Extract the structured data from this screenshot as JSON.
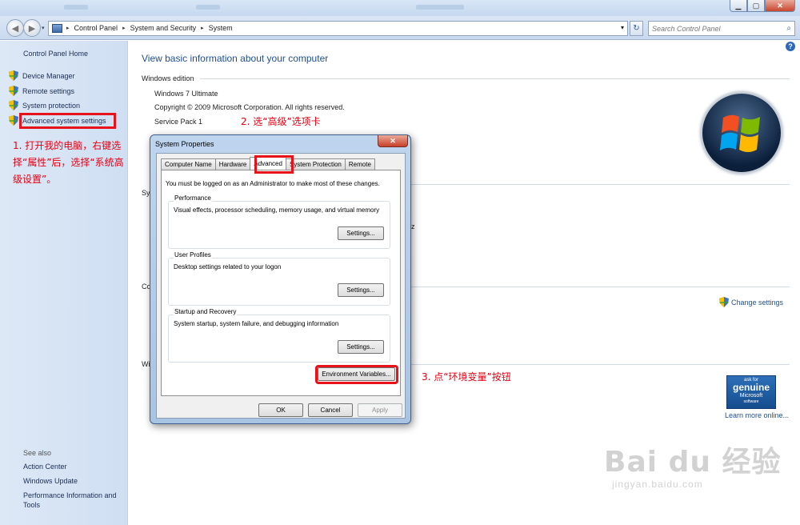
{
  "window": {
    "minimize_glyph": "▁",
    "maximize_glyph": "▢",
    "close_glyph": "✕"
  },
  "nav": {
    "back_glyph": "◀",
    "forward_glyph": "▶",
    "dropdown_glyph": "▾",
    "breadcrumb": [
      "Control Panel",
      "System and Security",
      "System"
    ],
    "separator_glyph": "▸",
    "refresh_glyph": "↻",
    "search_placeholder": "Search Control Panel",
    "search_glyph": "⌕"
  },
  "sidebar": {
    "home": "Control Panel Home",
    "items": [
      {
        "label": "Device Manager",
        "icon": "shield-icon"
      },
      {
        "label": "Remote settings",
        "icon": "shield-icon"
      },
      {
        "label": "System protection",
        "icon": "shield-icon"
      },
      {
        "label": "Advanced system settings",
        "icon": "shield-icon"
      }
    ],
    "see_also": "See also",
    "see_also_links": [
      "Action Center",
      "Windows Update",
      "Performance Information and Tools"
    ]
  },
  "main": {
    "title": "View basic information about your computer",
    "help_glyph": "?",
    "edition_header": "Windows edition",
    "edition_lines": [
      "Windows 7 Ultimate",
      "Copyright © 2009 Microsoft Corporation.  All rights reserved.",
      "Service Pack 1"
    ],
    "partial_labels": [
      "Sy",
      "Co",
      "Wi",
      "z"
    ],
    "change_settings": "Change settings",
    "genuine": {
      "line1": "ask for",
      "line2": "genuine",
      "line3": "Microsoft",
      "line4": "software"
    },
    "learn_more": "Learn more online..."
  },
  "annotations": {
    "step1": "1. 打开我的电脑，右键选择“属性”后，选择“系统高级设置”。",
    "step2": "2. 选“高级”选项卡",
    "step3": "3. 点“环境变量”按钮",
    "highlight_color": "#e8121b"
  },
  "dialog": {
    "title": "System Properties",
    "close_glyph": "✕",
    "tabs": [
      "Computer Name",
      "Hardware",
      "Advanced",
      "System Protection",
      "Remote"
    ],
    "active_tab": "Advanced",
    "admin_note": "You must be logged on as an Administrator to make most of these changes.",
    "groups": [
      {
        "label": "Performance",
        "desc": "Visual effects, processor scheduling, memory usage, and virtual memory",
        "button": "Settings..."
      },
      {
        "label": "User Profiles",
        "desc": "Desktop settings related to your logon",
        "button": "Settings..."
      },
      {
        "label": "Startup and Recovery",
        "desc": "System startup, system failure, and debugging information",
        "button": "Settings..."
      }
    ],
    "env_button": "Environment Variables...",
    "ok": "OK",
    "cancel": "Cancel",
    "apply": "Apply"
  },
  "watermark": {
    "brand": "Bai du 经验",
    "url": "jingyan.baidu.com"
  }
}
